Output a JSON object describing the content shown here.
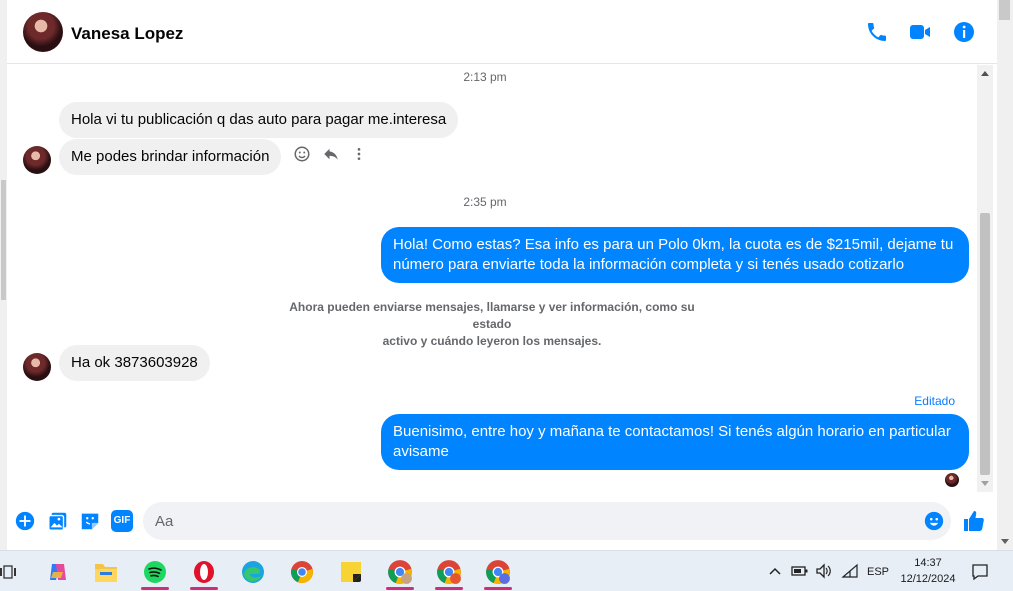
{
  "contact": {
    "name": "Vanesa Lopez"
  },
  "icons": {
    "call": "phone-icon",
    "video": "video-camera-icon",
    "info": "info-icon",
    "react": "emoji-icon",
    "reply": "reply-icon",
    "more": "more-vertical-icon",
    "plus": "plus-circle-icon",
    "gallery": "gallery-icon",
    "sticker": "sticker-icon",
    "gif": "gif-icon",
    "emoji": "emoji-icon",
    "like": "thumbs-up-icon"
  },
  "colors": {
    "accent": "#0084ff",
    "incoming": "#f0f0f0",
    "meta": "#65676b"
  },
  "messages": {
    "time1": "2:13 pm",
    "in1": "Hola vi tu publicación q das auto para pagar me.interesa",
    "in2": "Me podes brindar información",
    "time2": "2:35 pm",
    "out1_line1": "Hola! Como estas? Esa info es para un Polo 0km, la cuota es de $215mil, dejame tu",
    "out1_line2": "número para enviarte toda la información completa y si tenés usado cotizarlo",
    "system_line1": "Ahora pueden enviarse mensajes, llamarse y ver información, como su estado",
    "system_line2": "activo y cuándo leyeron los mensajes.",
    "in3": "Ha ok 3873603928",
    "edited": "Editado",
    "out2_line1": "Buenisimo, entre hoy y mañana te contactamos! Si tenés algún horario en particular",
    "out2_line2": "avisame"
  },
  "composer": {
    "placeholder": "Aa",
    "gif_label": "GIF"
  },
  "taskbar": {
    "language": "ESP",
    "time": "14:37",
    "date": "12/12/2024"
  }
}
